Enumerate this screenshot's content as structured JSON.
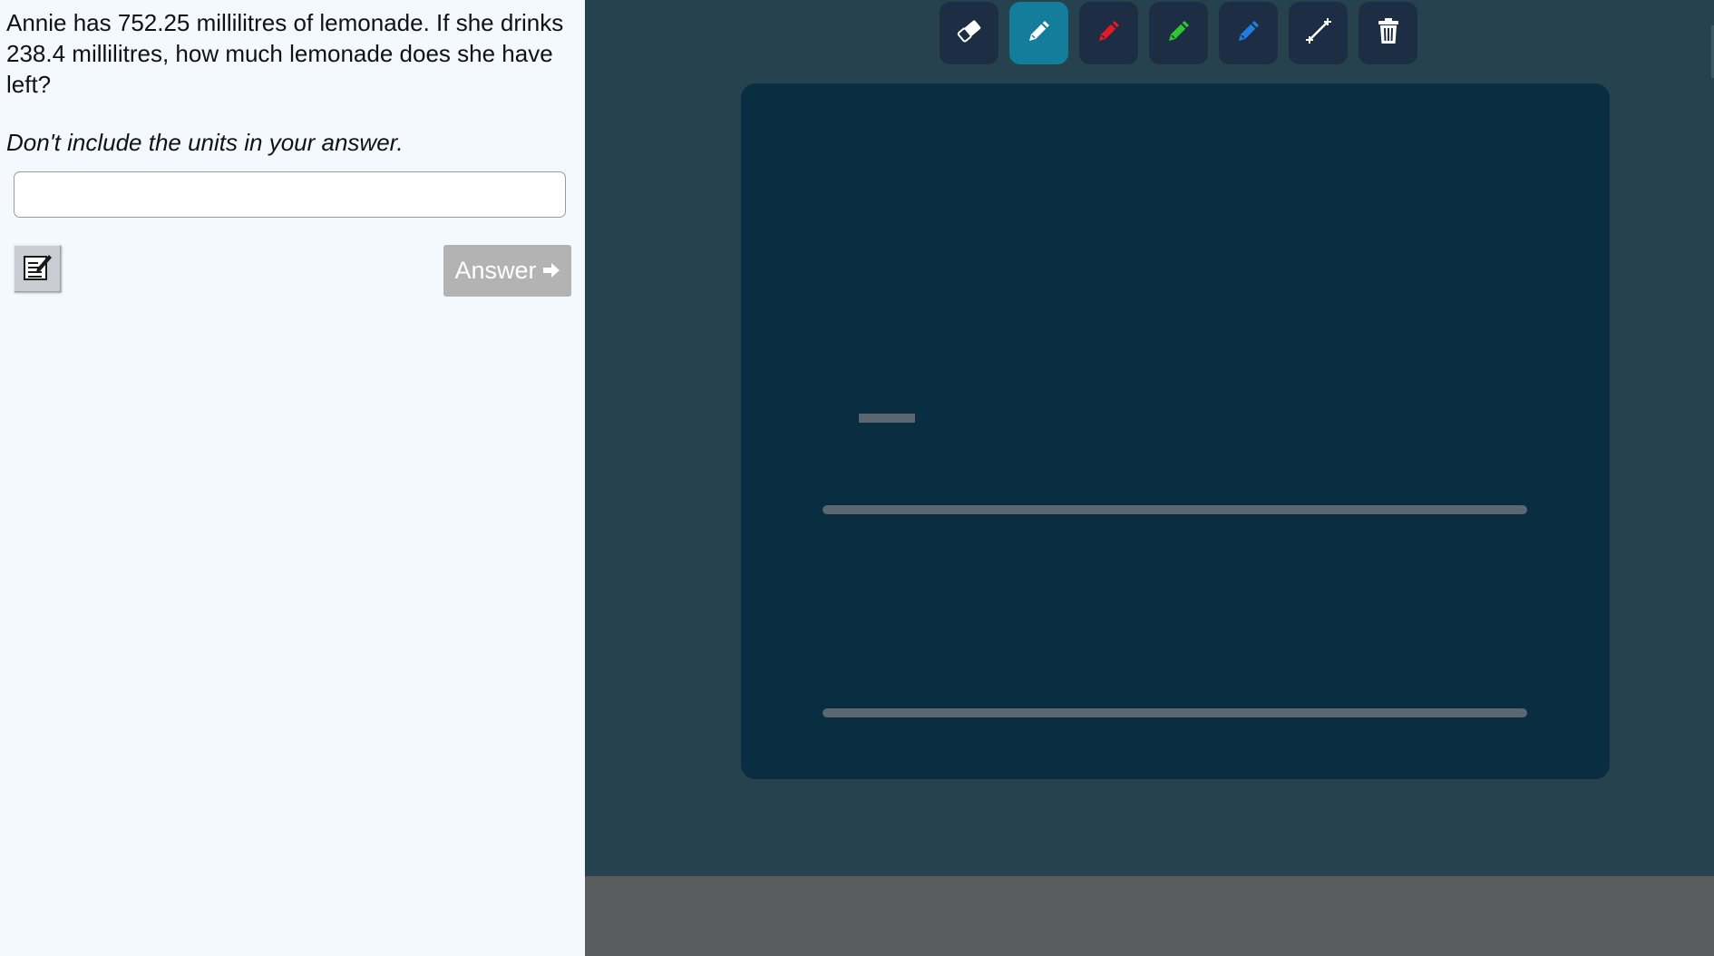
{
  "question": {
    "text": "Annie has 752.25 millilitres of lemonade. If she drinks 238.4 millilitres, how much lemonade does she have left?",
    "instruction": "Don't include the units in your answer."
  },
  "answer_input": {
    "value": "",
    "placeholder": ""
  },
  "notepad_button": {
    "icon": "notepad-icon"
  },
  "submit_button": {
    "label": "Answer",
    "icon": "arrow-right-icon"
  },
  "toolbar": {
    "tools": [
      {
        "name": "eraser",
        "icon": "eraser-icon",
        "active": false
      },
      {
        "name": "white-pen",
        "icon": "pencil-icon",
        "color": "#ffffff",
        "active": true
      },
      {
        "name": "red-pen",
        "icon": "pencil-icon",
        "color": "#e01b24",
        "active": false
      },
      {
        "name": "green-pen",
        "icon": "pencil-icon",
        "color": "#2ec72e",
        "active": false
      },
      {
        "name": "blue-pen",
        "icon": "pencil-icon",
        "color": "#1f7fe0",
        "active": false
      },
      {
        "name": "line",
        "icon": "line-tool-icon",
        "active": false
      },
      {
        "name": "clear",
        "icon": "trash-icon",
        "active": false
      }
    ]
  },
  "colors": {
    "left_background": "#f3f9ff",
    "workspace_background": "#26424f",
    "canvas_background": "#0a2e41",
    "active_tool": "#137d9b",
    "tool_background": "#1d2d44",
    "answer_button": "#b3b3b3",
    "bottom_bar": "#5b5c5e"
  }
}
